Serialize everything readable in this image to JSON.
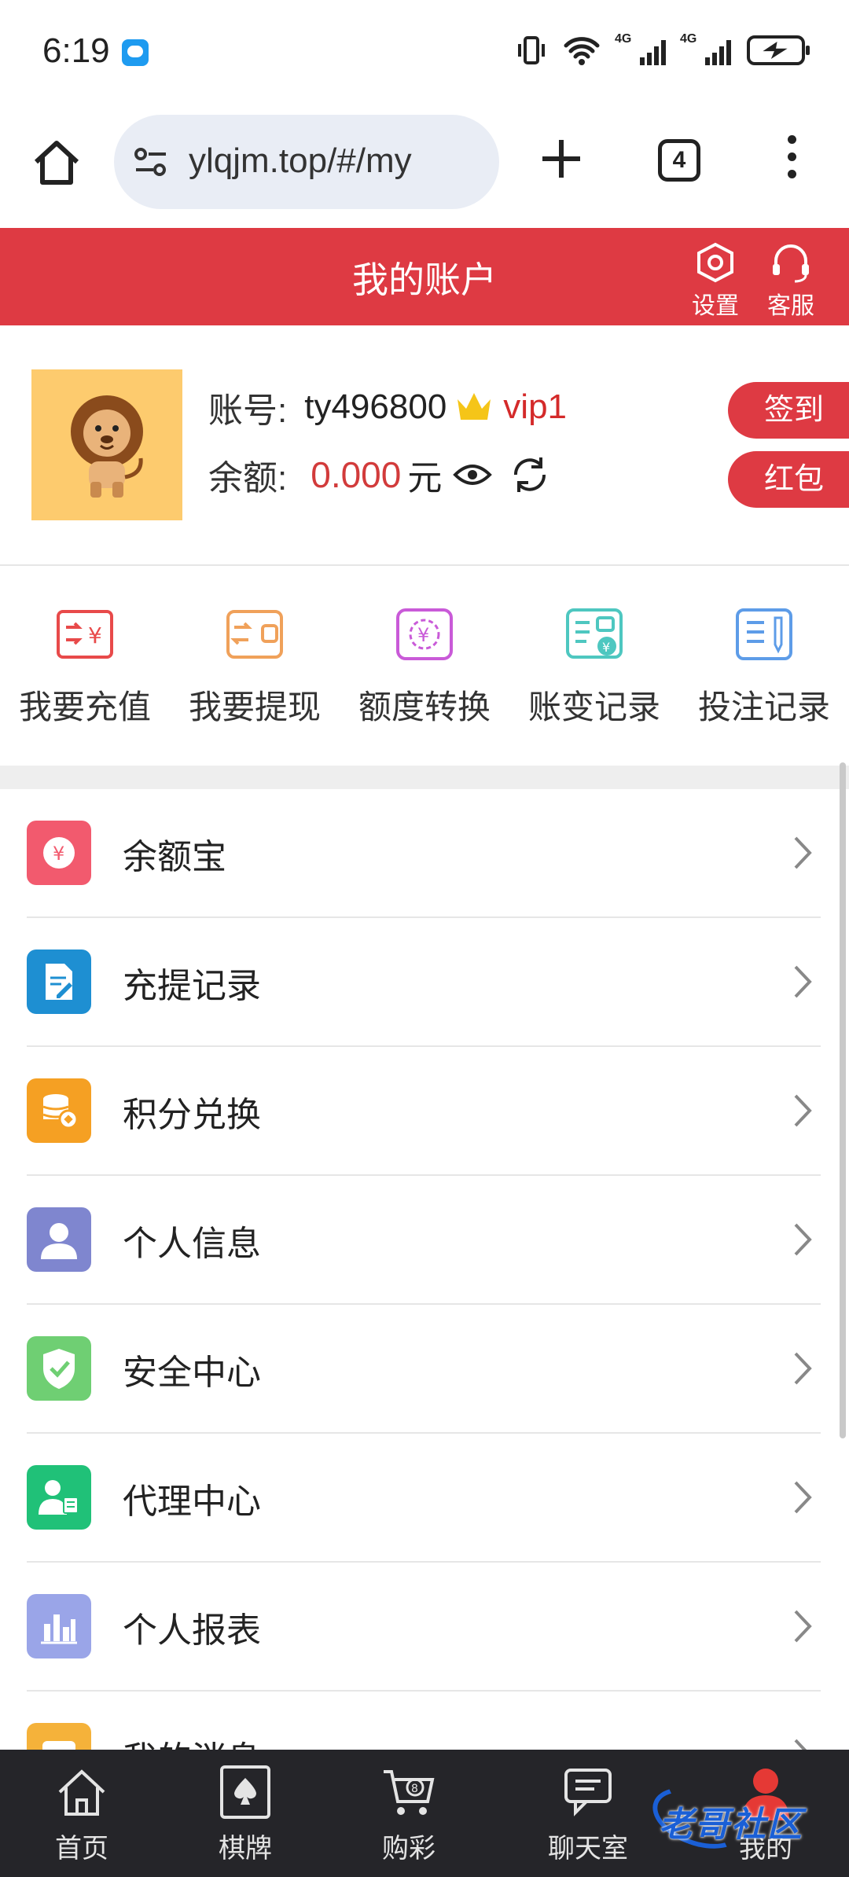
{
  "status_bar": {
    "time": "6:19",
    "net1": "4G",
    "net2": "4G"
  },
  "browser": {
    "url": "ylqjm.top/#/my",
    "tab_count": "4"
  },
  "header": {
    "title": "我的账户",
    "settings_label": "设置",
    "service_label": "客服"
  },
  "account": {
    "account_label": "账号:",
    "account_id": "ty496800",
    "vip": "vip1",
    "balance_label": "余额:",
    "balance": "0.000",
    "currency": "元",
    "checkin_label": "签到",
    "redpacket_label": "红包"
  },
  "quick_actions": [
    {
      "label": "我要充值",
      "icon": "recharge-icon",
      "color": "#e84a4a"
    },
    {
      "label": "我要提现",
      "icon": "withdraw-icon",
      "color": "#f0a15a"
    },
    {
      "label": "额度转换",
      "icon": "transfer-icon",
      "color": "#c95ad8"
    },
    {
      "label": "账变记录",
      "icon": "ledger-icon",
      "color": "#4ec7c0"
    },
    {
      "label": "投注记录",
      "icon": "bet-record-icon",
      "color": "#5d9ce8"
    }
  ],
  "menu": [
    {
      "label": "余额宝",
      "icon": "yuebao-icon",
      "color": "#f25a6e"
    },
    {
      "label": "充提记录",
      "icon": "records-icon",
      "color": "#1e8fd2"
    },
    {
      "label": "积分兑换",
      "icon": "points-icon",
      "color": "#f5a023"
    },
    {
      "label": "个人信息",
      "icon": "user-icon",
      "color": "#7f86cf"
    },
    {
      "label": "安全中心",
      "icon": "shield-icon",
      "color": "#6fcf73"
    },
    {
      "label": "代理中心",
      "icon": "agent-icon",
      "color": "#20c178"
    },
    {
      "label": "个人报表",
      "icon": "report-icon",
      "color": "#9aa5e8"
    },
    {
      "label": "我的消息",
      "icon": "message-icon",
      "color": "#f5b23a"
    }
  ],
  "bottom_nav": [
    {
      "label": "首页",
      "icon": "home-icon"
    },
    {
      "label": "棋牌",
      "icon": "cards-icon"
    },
    {
      "label": "购彩",
      "icon": "lottery-cart-icon"
    },
    {
      "label": "聊天室",
      "icon": "chat-icon"
    },
    {
      "label": "我的",
      "icon": "profile-icon",
      "active_color": "#e53935"
    }
  ],
  "watermark": "老哥社区"
}
